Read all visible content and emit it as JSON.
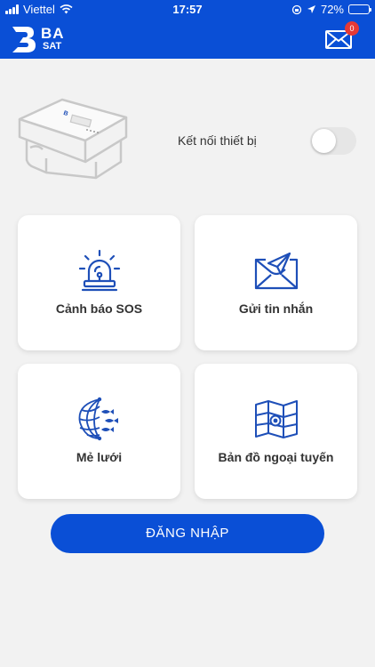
{
  "status_bar": {
    "carrier": "Viettel",
    "time": "17:57",
    "battery": "72%"
  },
  "header": {
    "logo_ba": "BA",
    "logo_sat": "SAT",
    "mail_badge": "0"
  },
  "device": {
    "connect_label": "Kết nối thiết bị",
    "connected": false
  },
  "menu": [
    {
      "label": "Cảnh báo SOS",
      "icon": "sos-alarm-icon"
    },
    {
      "label": "Gửi tin nhắn",
      "icon": "send-message-icon"
    },
    {
      "label": "Mẻ lưới",
      "icon": "fishing-net-icon"
    },
    {
      "label": "Bản đồ ngoại tuyến",
      "icon": "offline-map-icon"
    }
  ],
  "login_label": "ĐĂNG NHẬP",
  "colors": {
    "primary": "#0a4fd6",
    "icon_blue": "#1e4fb8",
    "badge_red": "#e53935",
    "background": "#f2f2f2"
  }
}
